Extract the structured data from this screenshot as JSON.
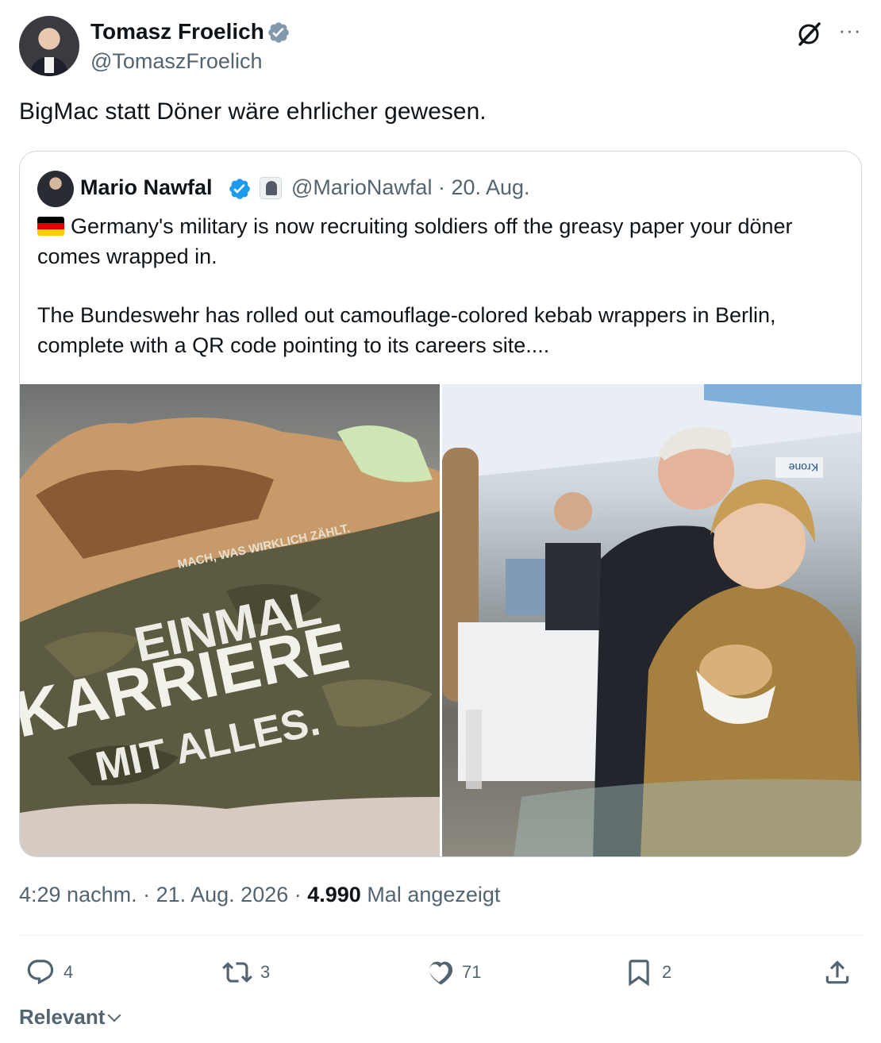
{
  "author": {
    "name": "Tomasz Froelich",
    "handle": "@TomaszFroelich",
    "avatar_icon": "profile-photo",
    "verified_icon": "verified-badge-icon",
    "verified_color": "#829aab"
  },
  "toolbar": {
    "grok_icon": "grok-icon",
    "more_icon": "more-options-icon",
    "more_glyph": "···"
  },
  "tweet": {
    "text": "BigMac statt Döner wäre ehrlicher gewesen."
  },
  "quoted": {
    "name": "Mario Nawfal",
    "handle_date": "@MarioNawfal · 20. Aug.",
    "verified_color": "#1d9bf0",
    "flag_colors": [
      "#000000",
      "#dd0000",
      "#ffce00"
    ],
    "line1": "Germany's military is now recruiting soldiers off the greasy paper your döner comes wrapped in.",
    "line2": "The Bundeswehr has rolled out camouflage-colored kebab wrappers in Berlin, complete with a QR code pointing to its careers site....",
    "image_left": {
      "wrapper_tagline": "MACH, WAS WIRKLICH ZÄHLT.",
      "wrapper_line1": "EINMAL",
      "wrapper_line2": "KARRIERE",
      "wrapper_line3": "MIT ALLES."
    },
    "image_right": {
      "sign_text": "Krone"
    }
  },
  "meta": {
    "time_date": "4:29 nachm. · 21. Aug. 2026 · ",
    "views_count": "4.990",
    "views_label": " Mal angezeigt"
  },
  "actions": {
    "replies": "4",
    "reposts": "3",
    "likes": "71",
    "bookmarks": "2"
  },
  "sort": {
    "label": "Relevant"
  }
}
